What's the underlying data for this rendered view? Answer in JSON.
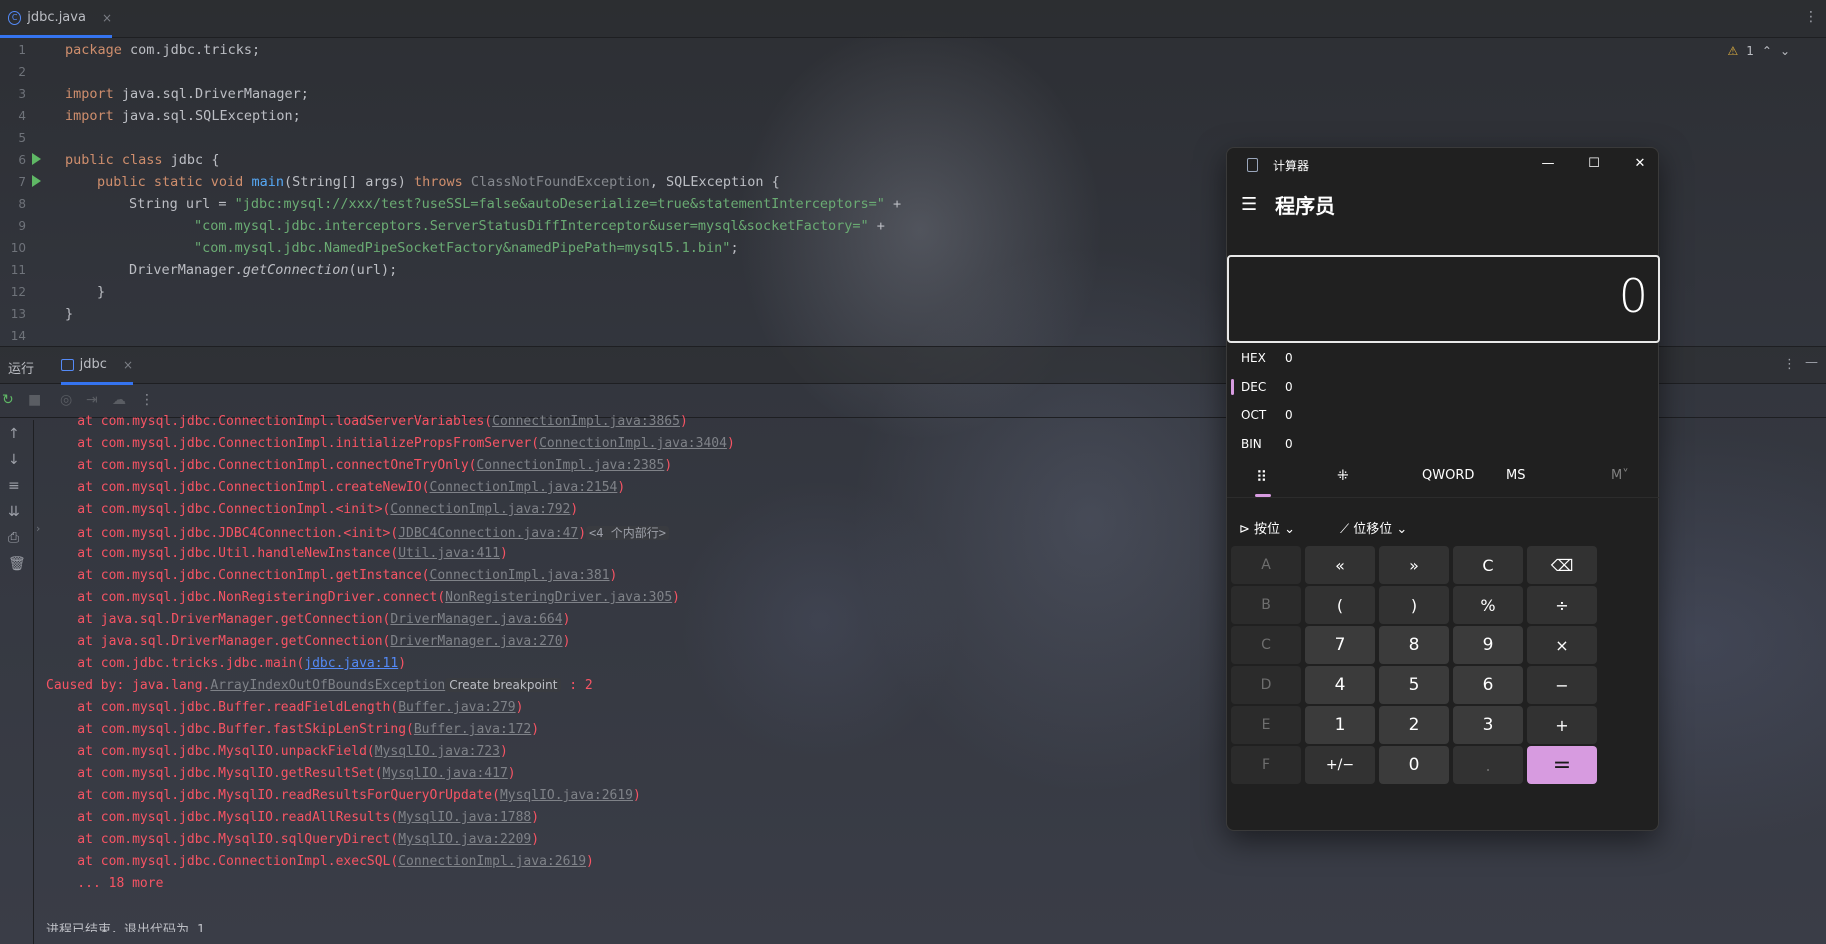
{
  "editor": {
    "tab_label": "jdbc.java",
    "tab_close": "×",
    "warning_count": "1",
    "line_numbers": [
      "1",
      "2",
      "3",
      "4",
      "5",
      "6",
      "7",
      "8",
      "9",
      "10",
      "11",
      "12",
      "13",
      "14"
    ],
    "lines": {
      "l1_kw": "package",
      "l1_rest": " com.jdbc.tricks;",
      "l3_kw": "import",
      "l3_rest": " java.sql.DriverManager;",
      "l4_kw": "import",
      "l4_rest": " java.sql.SQLException;",
      "l6_kw": "public class",
      "l6_rest": " jdbc {",
      "l7_kw1": "public static void",
      "l7_fn": " main",
      "l7_a": "(String[] args) ",
      "l7_kw2": "throws",
      "l7_dim": " ClassNotFoundException",
      "l7_b": ", SQLException {",
      "l8_a": "String url = ",
      "l8_str": "\"jdbc:mysql://xxx/test?useSSL=false&autoDeserialize=true&statementInterceptors=\"",
      "l8_b": " +",
      "l9_str": "\"com.mysql.jdbc.interceptors.ServerStatusDiffInterceptor&user=mysql&socketFactory=\"",
      "l9_b": " +",
      "l10_str": "\"com.mysql.jdbc.NamedPipeSocketFactory&namedPipePath=mysql5.1.bin\"",
      "l10_b": ";",
      "l11_a": "DriverManager.",
      "l11_it": "getConnection",
      "l11_b": "(url);",
      "l12": "}",
      "l13": "}"
    }
  },
  "run": {
    "label": "运行",
    "tab_label": "jdbc",
    "tab_close": "×",
    "console": [
      {
        "pre": "    at com.mysql.jdbc.ConnectionImpl.loadServerVariables(",
        "link": "ConnectionImpl.java:3865",
        "post": ")"
      },
      {
        "pre": "    at com.mysql.jdbc.ConnectionImpl.initializePropsFromServer(",
        "link": "ConnectionImpl.java:3404",
        "post": ")"
      },
      {
        "pre": "    at com.mysql.jdbc.ConnectionImpl.connectOneTryOnly(",
        "link": "ConnectionImpl.java:2385",
        "post": ")"
      },
      {
        "pre": "    at com.mysql.jdbc.ConnectionImpl.createNewIO(",
        "link": "ConnectionImpl.java:2154",
        "post": ")"
      },
      {
        "pre": "    at com.mysql.jdbc.ConnectionImpl.<init>(",
        "link": "ConnectionImpl.java:792",
        "post": ")"
      },
      {
        "pre": "    at com.mysql.jdbc.JDBC4Connection.<init>(",
        "link": "JDBC4Connection.java:47",
        "post": ")",
        "chip": "<4 个内部行>"
      },
      {
        "pre": "    at com.mysql.jdbc.Util.handleNewInstance(",
        "link": "Util.java:411",
        "post": ")"
      },
      {
        "pre": "    at com.mysql.jdbc.ConnectionImpl.getInstance(",
        "link": "ConnectionImpl.java:381",
        "post": ")"
      },
      {
        "pre": "    at com.mysql.jdbc.NonRegisteringDriver.connect(",
        "link": "NonRegisteringDriver.java:305",
        "post": ")"
      },
      {
        "pre": "    at java.sql.DriverManager.getConnection(",
        "link": "DriverManager.java:664",
        "post": ")"
      },
      {
        "pre": "    at java.sql.DriverManager.getConnection(",
        "link": "DriverManager.java:270",
        "post": ")"
      },
      {
        "pre": "    at com.jdbc.tricks.jdbc.main(",
        "linkb": "jdbc.java:11",
        "post": ")"
      },
      {
        "pre": "Caused by: java.lang.",
        "link": "ArrayIndexOutOfBoundsException",
        "chip2": "Create breakpoint",
        "post": " : 2"
      },
      {
        "pre": "    at com.mysql.jdbc.Buffer.readFieldLength(",
        "link": "Buffer.java:279",
        "post": ")"
      },
      {
        "pre": "    at com.mysql.jdbc.Buffer.fastSkipLenString(",
        "link": "Buffer.java:172",
        "post": ")"
      },
      {
        "pre": "    at com.mysql.jdbc.MysqlIO.unpackField(",
        "link": "MysqlIO.java:723",
        "post": ")"
      },
      {
        "pre": "    at com.mysql.jdbc.MysqlIO.getResultSet(",
        "link": "MysqlIO.java:417",
        "post": ")"
      },
      {
        "pre": "    at com.mysql.jdbc.MysqlIO.readResultsForQueryOrUpdate(",
        "link": "MysqlIO.java:2619",
        "post": ")"
      },
      {
        "pre": "    at com.mysql.jdbc.MysqlIO.readAllResults(",
        "link": "MysqlIO.java:1788",
        "post": ")"
      },
      {
        "pre": "    at com.mysql.jdbc.MysqlIO.sqlQueryDirect(",
        "link": "MysqlIO.java:2209",
        "post": ")"
      },
      {
        "pre": "    at com.mysql.jdbc.ConnectionImpl.execSQL(",
        "link": "ConnectionImpl.java:2619",
        "post": ")"
      },
      {
        "pre": "    ... 18 more"
      }
    ],
    "exit_message": "进程已结束，退出代码为 1"
  },
  "calculator": {
    "title": "计算器",
    "mode": "程序员",
    "display": "0",
    "bases": [
      {
        "key": "HEX",
        "value": "0"
      },
      {
        "key": "DEC",
        "value": "0"
      },
      {
        "key": "OCT",
        "value": "0"
      },
      {
        "key": "BIN",
        "value": "0"
      }
    ],
    "word_size": "QWORD",
    "ms": "MS",
    "mem": "M˅",
    "bitwise": "按位",
    "bitshift": "位移位",
    "keys": [
      [
        "A",
        "«",
        "»",
        "C",
        "⌫"
      ],
      [
        "B",
        "(",
        ")",
        "%",
        "÷"
      ],
      [
        "C",
        "7",
        "8",
        "9",
        "×"
      ],
      [
        "D",
        "4",
        "5",
        "6",
        "−"
      ],
      [
        "E",
        "1",
        "2",
        "3",
        "+"
      ],
      [
        "F",
        "+/−",
        "0",
        ".",
        "="
      ]
    ],
    "colors": {
      "accent": "#d79be0",
      "bg": "#202020"
    }
  }
}
